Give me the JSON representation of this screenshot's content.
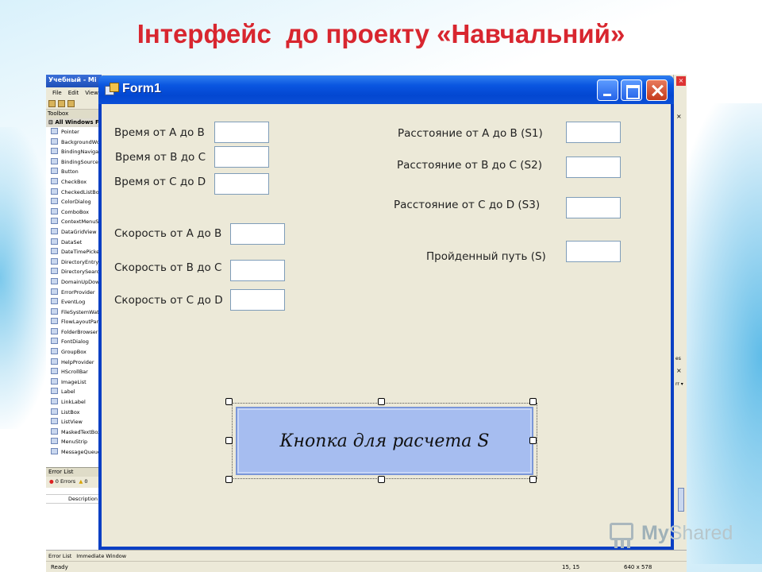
{
  "slide": {
    "title": "Інтерфейс  до проекту «Навчальний»"
  },
  "ide": {
    "title_partial": "Учебный - Mi",
    "menu": [
      "File",
      "Edit",
      "View"
    ],
    "toolbox_header": "Toolbox",
    "toolbox_group": "All Windows Fo",
    "toolbox_items": [
      "Pointer",
      "BackgroundWor",
      "BindingNavigato",
      "BindingSource",
      "Button",
      "CheckBox",
      "CheckedListBox",
      "ColorDialog",
      "ComboBox",
      "ContextMenuSt",
      "DataGridView",
      "DataSet",
      "DateTimePicker",
      "DirectoryEntry",
      "DirectorySearch",
      "DomainUpDown",
      "ErrorProvider",
      "EventLog",
      "FileSystemWatc",
      "FlowLayoutPan",
      "FolderBrowserD",
      "FontDialog",
      "GroupBox",
      "HelpProvider",
      "HScrollBar",
      "ImageList",
      "Label",
      "LinkLabel",
      "ListBox",
      "ListView",
      "MaskedTextBox",
      "MenuStrip",
      "MessageQueue"
    ],
    "error_list": {
      "header": "Error List",
      "errors": "0 Errors",
      "warnings": "0",
      "column": "Description"
    },
    "bottom_tabs": [
      "Error List",
      "Immediate Window"
    ],
    "status": {
      "ready": "Ready",
      "position": "15, 15",
      "size": "640 x 578"
    },
    "right_panel": {
      "label": "es",
      "dropdown": "rr ▾"
    }
  },
  "form": {
    "title": "Form1",
    "labels": {
      "time_ab": "Время от А до В",
      "time_bc": "Время от В до С",
      "time_cd": "Время от С до D",
      "speed_ab": "Скорость от А до В",
      "speed_bc": "Скорость от В до С",
      "speed_cd": "Скорость от С до D",
      "dist_ab": "Расстояние от А до В (S1)",
      "dist_bc": "Расстояние от В до С (S2)",
      "dist_cd": "Расстояние от С до D  (S3)",
      "total": "Пройденный путь (S)"
    },
    "calc_button": "Кнопка для расчета S"
  },
  "watermark": {
    "text_a": "My",
    "text_b": "Shared"
  }
}
